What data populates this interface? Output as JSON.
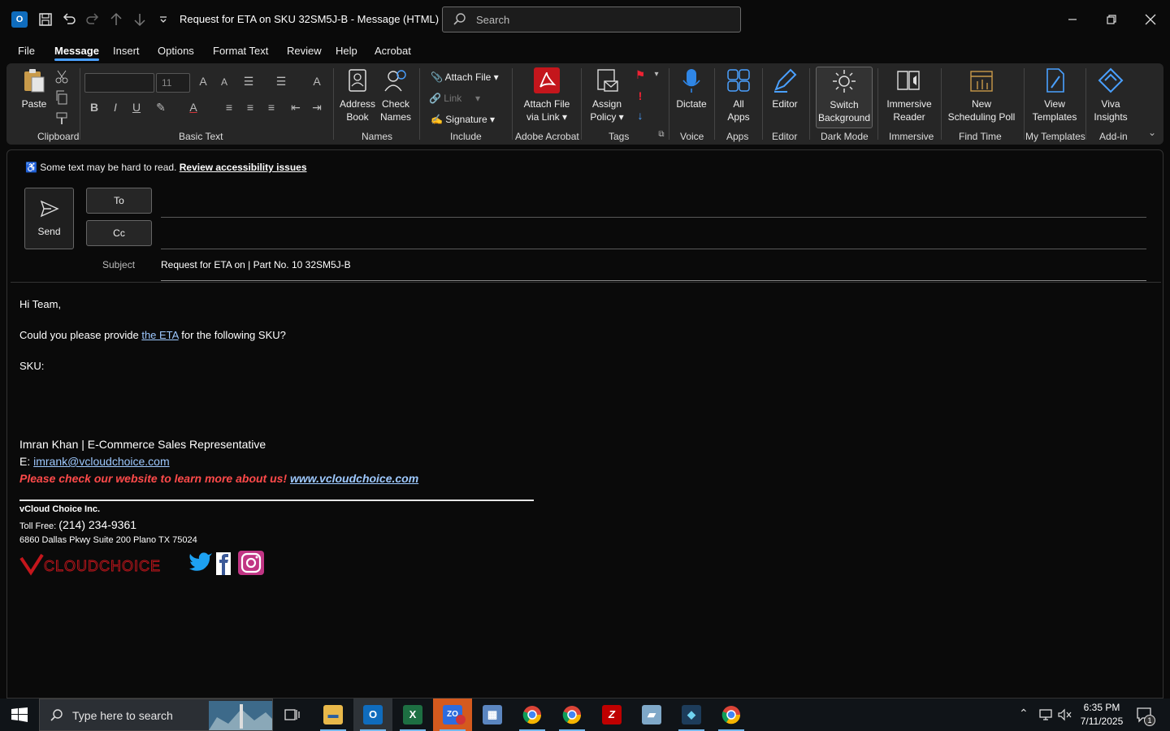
{
  "window": {
    "title": "Request for ETA on SKU 32SM5J-B  -  Message (HTML)",
    "search_placeholder": "Search"
  },
  "tabs": [
    "File",
    "Message",
    "Insert",
    "Options",
    "Format Text",
    "Review",
    "Help",
    "Acrobat"
  ],
  "ribbon": {
    "paste_label": "Paste",
    "font_size": "11",
    "groups": {
      "clipboard": "Clipboard",
      "basic_text": "Basic Text",
      "names": "Names",
      "include": "Include",
      "adobe": "Adobe Acrobat",
      "tags": "Tags",
      "voice": "Voice",
      "apps": "Apps",
      "editor": "Editor",
      "dark_mode": "Dark Mode",
      "immersive": "Immersive",
      "find_time": "Find Time",
      "my_templates": "My Templates",
      "addin": "Add-in"
    },
    "buttons": {
      "address_book": [
        "Address",
        "Book"
      ],
      "check_names": [
        "Check",
        "Names"
      ],
      "attach_file": "Attach File",
      "link": "Link",
      "signature": "Signature",
      "attach_via_link": [
        "Attach File",
        "via Link"
      ],
      "assign_policy": [
        "Assign",
        "Policy"
      ],
      "dictate": "Dictate",
      "all_apps": [
        "All",
        "Apps"
      ],
      "editor": "Editor",
      "switch_background": [
        "Switch",
        "Background"
      ],
      "immersive_reader": [
        "Immersive",
        "Reader"
      ],
      "scheduling_poll": [
        "New",
        "Scheduling Poll"
      ],
      "view_templates": [
        "View",
        "Templates"
      ],
      "viva_insights": [
        "Viva",
        "Insights"
      ]
    }
  },
  "compose": {
    "accessibility_text": "Some text may be hard to read.",
    "accessibility_link": "Review accessibility issues",
    "send_label": "Send",
    "to_label": "To",
    "cc_label": "Cc",
    "subject_label": "Subject",
    "subject_value": "Request for ETA on | Part No. 10 32SM5J-B"
  },
  "body": {
    "greeting": "Hi Team,",
    "line1_pre": "Could you please provide ",
    "line1_link": "the  ETA",
    "line1_post": " for the following SKU?",
    "sku_label": "SKU:"
  },
  "signature": {
    "name_line": "Imran Khan | E-Commerce Sales Representative",
    "email_prefix": "E: ",
    "email": "imrank@vcloudchoice.com",
    "promo": "Please check our website to learn more about us! ",
    "website": "www.vcloudchoice.com",
    "company": "vCloud Choice Inc.",
    "phone_prefix": "Toll Free: ",
    "phone": "(214) 234-9361",
    "address": "6860 Dallas Pkwy Suite 200 Plano TX 75024",
    "logo_text": "VCLOUDCHOICE"
  },
  "taskbar": {
    "search_placeholder": "Type here to search",
    "time": "6:35 PM",
    "date": "7/11/2025",
    "notification_count": "1",
    "zoom_badge": "1"
  }
}
